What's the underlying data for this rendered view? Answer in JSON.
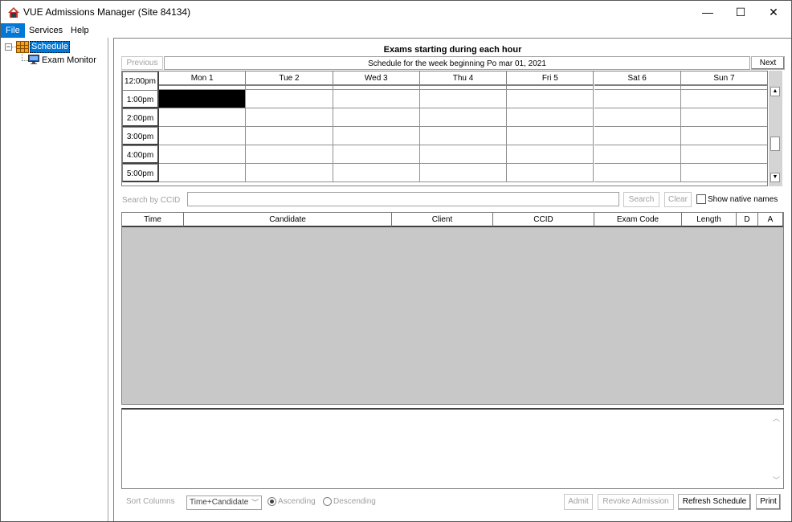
{
  "window": {
    "title": "VUE Admissions Manager (Site 84134)",
    "minimize": "—",
    "maximize": "☐",
    "close": "✕"
  },
  "menu": [
    "File",
    "Services",
    "Help"
  ],
  "tree": {
    "toggle": "−",
    "root": "Schedule",
    "child": "Exam Monitor"
  },
  "schedule": {
    "title": "Exams starting during each hour",
    "week_label": "Schedule for the week beginning Po mar 01, 2021",
    "previous": "Previous",
    "next": "Next",
    "days": [
      "Mon 1",
      "Tue 2",
      "Wed 3",
      "Thu 4",
      "Fri 5",
      "Sat 6",
      "Sun 7"
    ],
    "hours": [
      "12:00pm",
      "1:00pm",
      "2:00pm",
      "3:00pm",
      "4:00pm",
      "5:00pm"
    ],
    "selected": {
      "hour": "1:00pm",
      "day": "Mon 1"
    }
  },
  "search": {
    "label": "Search by CCID",
    "value": "",
    "search_btn": "Search",
    "clear_btn": "Clear",
    "native_names": "Show native names",
    "native_names_checked": false
  },
  "table": {
    "columns": [
      "Time",
      "Candidate",
      "Client",
      "CCID",
      "Exam Code",
      "Length",
      "D",
      "A"
    ],
    "rows": []
  },
  "footer": {
    "sort_label": "Sort Columns",
    "sort_value": "Time+Candidate",
    "ascending": "Ascending",
    "descending": "Descending",
    "admit": "Admit",
    "revoke": "Revoke Admission",
    "refresh": "Refresh Schedule",
    "print": "Print"
  },
  "colors": {
    "accent": "#0078d7",
    "selection": "#000000",
    "table_bg": "#c8c8c8"
  }
}
